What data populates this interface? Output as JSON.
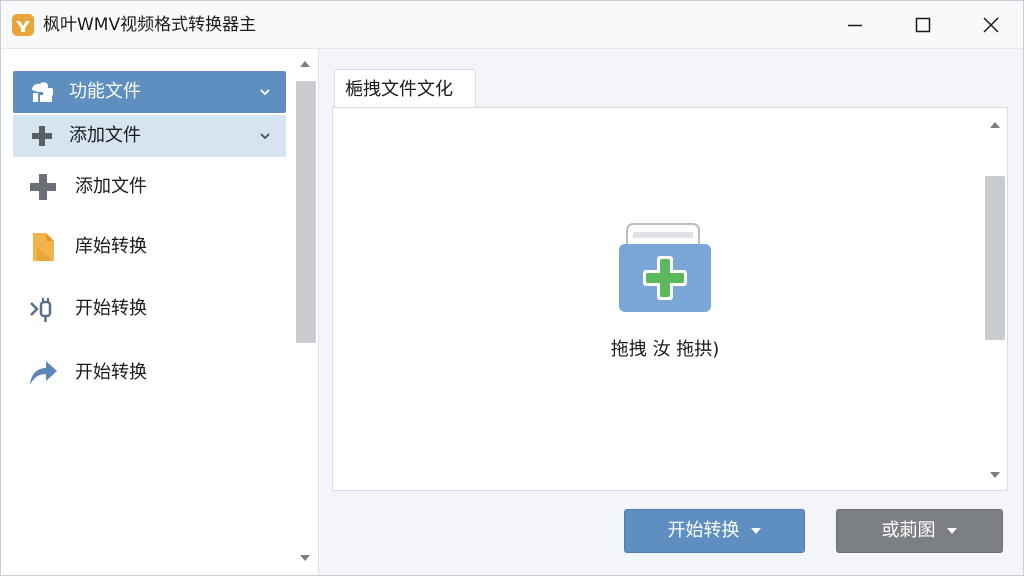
{
  "app": {
    "title": "枫叶WMV视频格式转换器主",
    "icon": "app-logo-icon"
  },
  "window_controls": [
    "minimize-icon",
    "maximize-icon",
    "close-icon"
  ],
  "sidebar": {
    "header": {
      "label": "功能文件",
      "icon": "settings-hand-icon"
    },
    "subheader": {
      "label": "添加文件",
      "icon": "plus-icon"
    },
    "items": [
      {
        "label": "添加文件",
        "icon": "plus-icon"
      },
      {
        "label": "庠始转换",
        "icon": "document-icon"
      },
      {
        "label": "开始转换",
        "icon": "plug-icon"
      },
      {
        "label": "开始转换",
        "icon": "share-arrow-icon"
      }
    ]
  },
  "main": {
    "tab_label": "梔拽文件文化",
    "drop_text": "拖拽  汝  拖拱)",
    "start_button": "开始转换",
    "other_button": "或莿圂"
  },
  "colors": {
    "accent": "#5f8fc1",
    "sub_highlight": "#d6e4f1",
    "gray_button": "#7c7f83",
    "plus_green": "#5cb85c",
    "folder_blue": "#7aa6d8"
  }
}
